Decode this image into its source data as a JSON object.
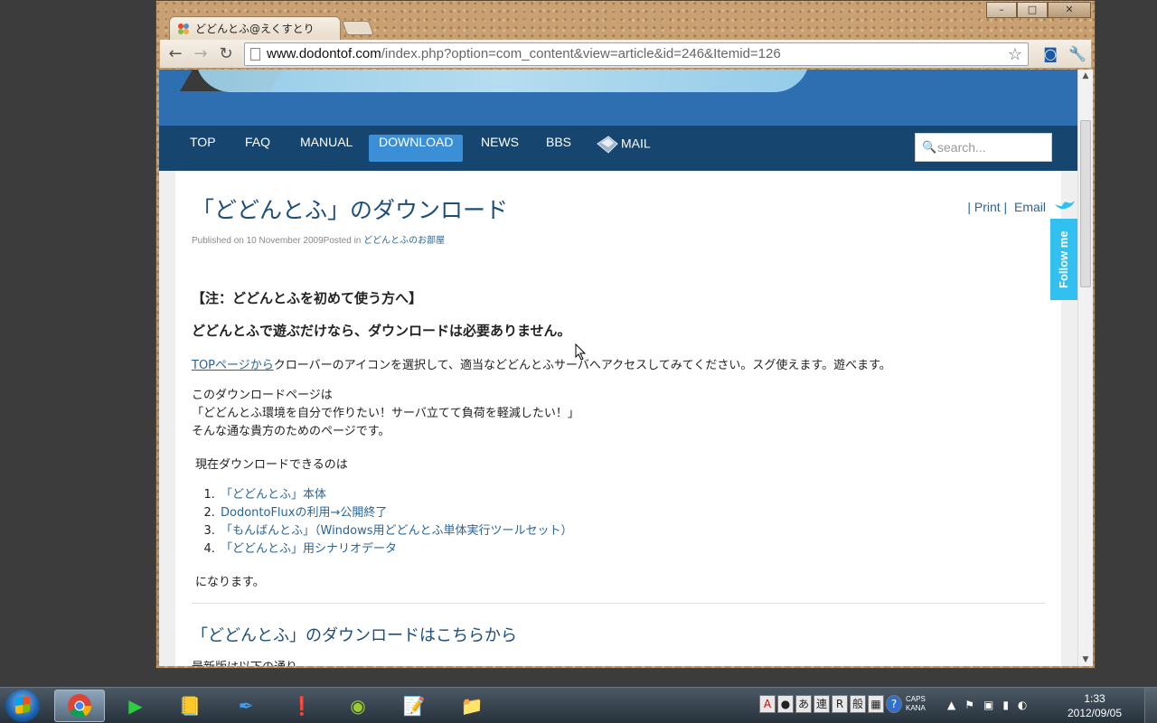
{
  "browser": {
    "tab_title": "どどんとふ@えくすとり",
    "url_host": "www.dodontof.com",
    "url_path": "/index.php?option=com_content&view=article&id=246&Itemid=126"
  },
  "site": {
    "nav": [
      "TOP",
      "FAQ",
      "MANUAL",
      "DOWNLOAD",
      "NEWS",
      "BBS",
      "MAIL"
    ],
    "active_nav": "DOWNLOAD",
    "search_placeholder": "search..."
  },
  "article": {
    "title": "「どどんとふ」のダウンロード",
    "published": "Published on 10 November 2009Posted in ",
    "category": "どどんとふのお部屋",
    "print": "| Print |",
    "email": "Email",
    "notice_heading": "【注：どどんとふを初めて使う方へ】",
    "notice_line": "どどんとふで遊ぶだけなら、ダウンロードは必要ありません。",
    "top_link": "TOPページから",
    "top_rest": "クローバーのアイコンを選択して、適当などどんとふサーバへアクセスしてみてください。スグ使えます。遊べます。",
    "intro_1": "このダウンロードページは",
    "intro_2": "「どどんとふ環境を自分で作りたい！サーバ立てて負荷を軽減したい！」",
    "intro_3": "そんな通な貴方のためのページです。",
    "available": "現在ダウンロードできるのは",
    "downloads": [
      "「どどんとふ」本体",
      "DodontoFluxの利用→公開終了",
      "「もんばんとふ」（Windows用どどんとふ単体実行ツールセット）",
      "「どどんとふ」用シナリオデータ"
    ],
    "closing": "になります。",
    "subheading": "「どどんとふ」のダウンロードはこちらから",
    "cut_text": "最新版は以下の通り"
  },
  "follow_label": "Follow me",
  "taskbar": {
    "ime": [
      "あ",
      "連",
      "R",
      "般"
    ],
    "caps": "CAPS",
    "kana": "KANA",
    "time": "1:33",
    "date": "2012/09/05"
  },
  "colors": {
    "banner": "#2e6fb2",
    "navbar": "#16466f",
    "nav_active": "#3b8fd6",
    "link": "#2a6496",
    "title": "#1d4e7a",
    "follow": "#32c0f0"
  }
}
